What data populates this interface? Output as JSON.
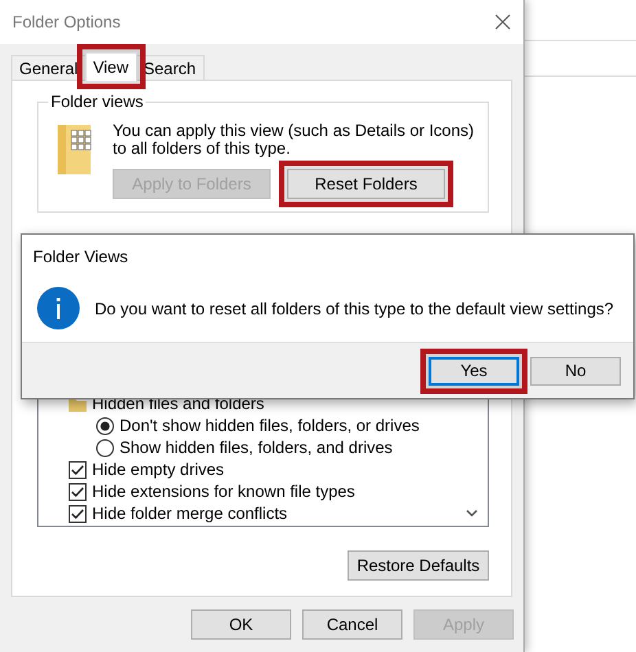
{
  "window": {
    "title": "Folder Options"
  },
  "tabs": [
    {
      "label": "General",
      "selected": false,
      "highlighted": false
    },
    {
      "label": "View",
      "selected": true,
      "highlighted": true
    },
    {
      "label": "Search",
      "selected": false,
      "highlighted": false
    }
  ],
  "folder_views": {
    "title": "Folder views",
    "description": "You can apply this view (such as Details or Icons) to all folders of this type.",
    "buttons": [
      {
        "label": "Apply to Folders",
        "disabled": true,
        "highlighted": false
      },
      {
        "label": "Reset Folders",
        "disabled": false,
        "highlighted": true
      }
    ]
  },
  "advanced_settings": {
    "items": [
      {
        "kind": "folder",
        "label": "Hidden files and folders",
        "children": [
          {
            "kind": "radio",
            "label": "Don't show hidden files, folders, or drives",
            "selected": true
          },
          {
            "kind": "radio",
            "label": "Show hidden files, folders, and drives",
            "selected": false
          }
        ]
      },
      {
        "kind": "checkbox",
        "label": "Hide empty drives",
        "checked": true
      },
      {
        "kind": "checkbox",
        "label": "Hide extensions for known file types",
        "checked": true
      },
      {
        "kind": "checkbox",
        "label": "Hide folder merge conflicts",
        "checked": true
      }
    ],
    "restore_button": "Restore Defaults"
  },
  "buttons": [
    {
      "label": "OK",
      "disabled": false
    },
    {
      "label": "Cancel",
      "disabled": false
    },
    {
      "label": "Apply",
      "disabled": true
    }
  ],
  "message_box": {
    "title": "Folder Views",
    "message": "Do you want to reset all folders of this type to the default view settings?",
    "buttons": [
      {
        "label": "Yes",
        "default": true,
        "highlighted": true
      },
      {
        "label": "No",
        "default": false,
        "highlighted": false
      }
    ]
  }
}
